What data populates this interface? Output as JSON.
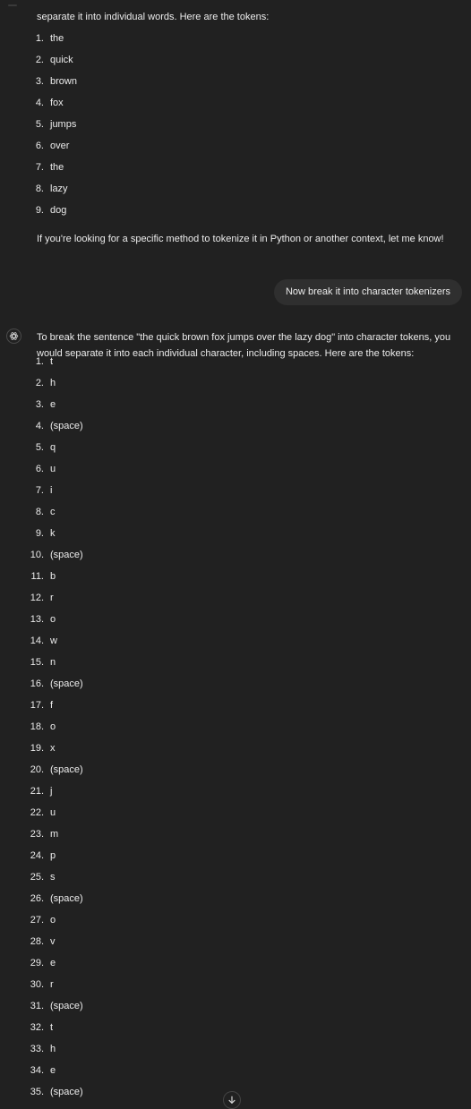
{
  "assistant_reply_1": {
    "intro": "separate it into individual words. Here are the tokens:",
    "tokens": [
      "the",
      "quick",
      "brown",
      "fox",
      "jumps",
      "over",
      "the",
      "lazy",
      "dog"
    ],
    "outro": "If you're looking for a specific method to tokenize it in Python or another context, let me know!"
  },
  "user_message": {
    "text": "Now break it into character tokenizers"
  },
  "assistant_reply_2": {
    "avatar_icon": "openai-logo-icon",
    "intro": "To break the sentence \"the quick brown fox jumps over the lazy dog\" into character tokens, you would separate it into each individual character, including spaces. Here are the tokens:",
    "tokens": [
      "t",
      "h",
      "e",
      "(space)",
      "q",
      "u",
      "i",
      "c",
      "k",
      "(space)",
      "b",
      "r",
      "o",
      "w",
      "n",
      "(space)",
      "f",
      "o",
      "x",
      "(space)",
      "j",
      "u",
      "m",
      "p",
      "s",
      "(space)",
      "o",
      "v",
      "e",
      "r",
      "(space)",
      "t",
      "h",
      "e",
      "(space)"
    ]
  },
  "scroll_button": {
    "icon": "arrow-down-icon"
  },
  "colors": {
    "background": "#212121",
    "text": "#ececec",
    "bubble": "#2f2f2f"
  }
}
